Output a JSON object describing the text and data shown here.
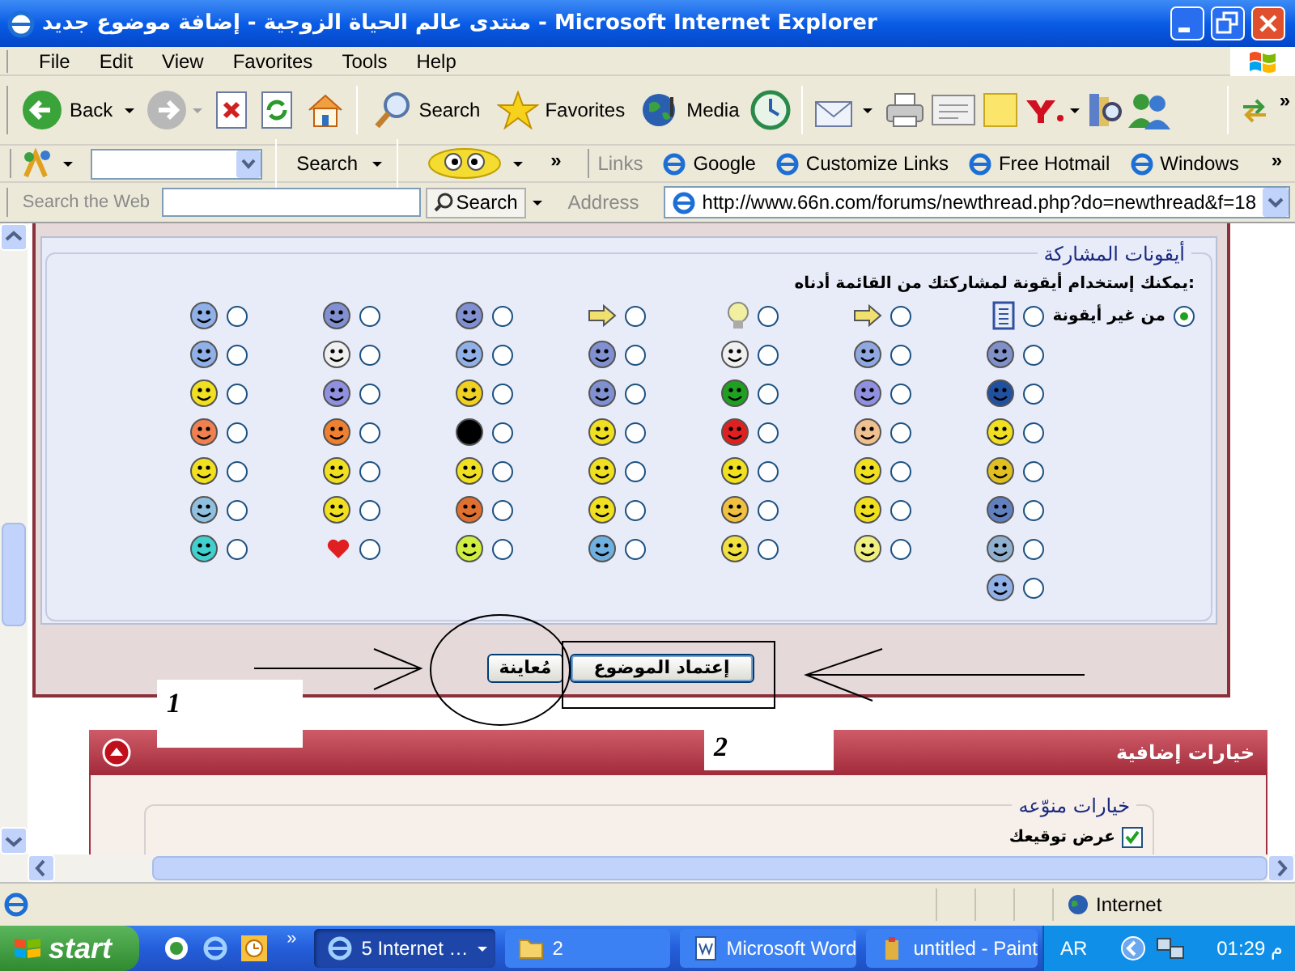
{
  "window": {
    "title": "منتدى عالم الحياة الزوجية - إضافة موضوع جديد - Microsoft Internet Explorer"
  },
  "menu": [
    "File",
    "Edit",
    "View",
    "Favorites",
    "Tools",
    "Help"
  ],
  "toolbar": {
    "back": "Back",
    "search": "Search",
    "favorites": "Favorites",
    "media": "Media",
    "chevron": "»"
  },
  "links_bar": {
    "search_button": "Search",
    "chevron": "»",
    "label": "Links",
    "links": [
      "Google",
      "Customize Links",
      "Free Hotmail",
      "Windows"
    ],
    "end_chevron": "»"
  },
  "search_bar": {
    "label": "Search the Web",
    "button": "Search",
    "address_label": "Address",
    "url": "http://www.66n.com/forums/newthread.php?do=newthread&f=18"
  },
  "post_icons": {
    "legend": "أيقونات المشاركة",
    "hint": "يمكنك إستخدام أيقونة لمشاركتك من القائمة أدناه:",
    "no_icon": {
      "label": "من غير أيقونة",
      "selected": true
    },
    "icons": [
      {
        "selected": false
      },
      {
        "selected": false
      },
      {
        "selected": false
      },
      {
        "selected": false
      },
      {
        "selected": false
      },
      {
        "selected": false
      },
      {
        "selected": false
      },
      {
        "selected": false
      },
      {
        "selected": false
      },
      {
        "selected": false
      },
      {
        "selected": false
      },
      {
        "selected": false
      },
      {
        "selected": false
      },
      {
        "selected": false
      },
      {
        "selected": false
      },
      {
        "selected": false
      },
      {
        "selected": false
      },
      {
        "selected": false
      },
      {
        "selected": false
      },
      {
        "selected": false
      },
      {
        "selected": false
      },
      {
        "selected": false
      },
      {
        "selected": false
      },
      {
        "selected": false
      },
      {
        "selected": false
      },
      {
        "selected": false
      },
      {
        "selected": false
      },
      {
        "selected": false
      },
      {
        "selected": false
      },
      {
        "selected": false
      },
      {
        "selected": false
      },
      {
        "selected": false
      },
      {
        "selected": false
      },
      {
        "selected": false
      },
      {
        "selected": false
      },
      {
        "selected": false
      },
      {
        "selected": false
      },
      {
        "selected": false
      },
      {
        "selected": false
      },
      {
        "selected": false
      },
      {
        "selected": false
      },
      {
        "selected": false
      },
      {
        "selected": false
      },
      {
        "selected": false
      },
      {
        "selected": false
      },
      {
        "selected": false
      },
      {
        "selected": false
      },
      {
        "selected": false
      },
      {
        "selected": false
      },
      {
        "selected": false
      }
    ]
  },
  "buttons": {
    "submit": "إعتماد الموضوع",
    "preview": "مُعاينة"
  },
  "annotations": [
    "1",
    "2"
  ],
  "extra_options": {
    "title": "خيارات إضافية",
    "fieldset": "خيارات منوّعه",
    "checkbox": {
      "label": "عرض توقيعك",
      "checked": true
    }
  },
  "status_bar": {
    "zone": "Internet"
  },
  "taskbar": {
    "start": "start",
    "chevron": "»",
    "tasks": [
      {
        "label": "5 Internet …",
        "selected": true,
        "kind": "browser"
      },
      {
        "label": "2",
        "selected": false,
        "kind": "folder"
      },
      {
        "label": "Microsoft Word",
        "selected": false,
        "kind": "word"
      },
      {
        "label": "untitled - Paint",
        "selected": false,
        "kind": "paint"
      }
    ],
    "language": "AR",
    "clock": "01:29 م"
  }
}
